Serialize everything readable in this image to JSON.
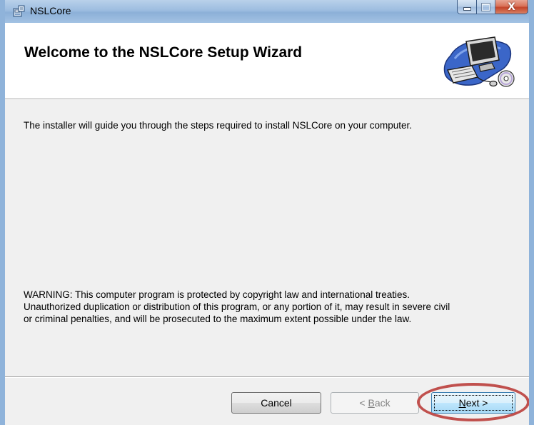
{
  "window": {
    "title": "NSLCore",
    "icons": {
      "app": "installer-package-icon",
      "minimize": "minimize-icon",
      "maximize": "maximize-icon",
      "close": "close-icon",
      "banner": "computer-setup-icon"
    },
    "close_glyph": "X"
  },
  "banner": {
    "title": "Welcome to the NSLCore Setup Wizard"
  },
  "body": {
    "intro": "The installer will guide you through the steps required to install NSLCore on your computer.",
    "warning_lines": [
      "WARNING: This computer program is protected by copyright law and international treaties.",
      "Unauthorized duplication or distribution of this program, or any portion of it, may result in severe civil",
      "or criminal penalties, and will be prosecuted to the maximum extent possible under the law."
    ]
  },
  "buttons": {
    "cancel": "Cancel",
    "back": {
      "prefix": "< ",
      "accel": "B",
      "rest": "ack",
      "enabled": false
    },
    "next": {
      "accel": "N",
      "rest": "ext >",
      "focused": true
    }
  },
  "colors": {
    "highlight": "#c0504d",
    "window_frame": "#8fb3da",
    "dialog_bg": "#f0f0f0"
  }
}
